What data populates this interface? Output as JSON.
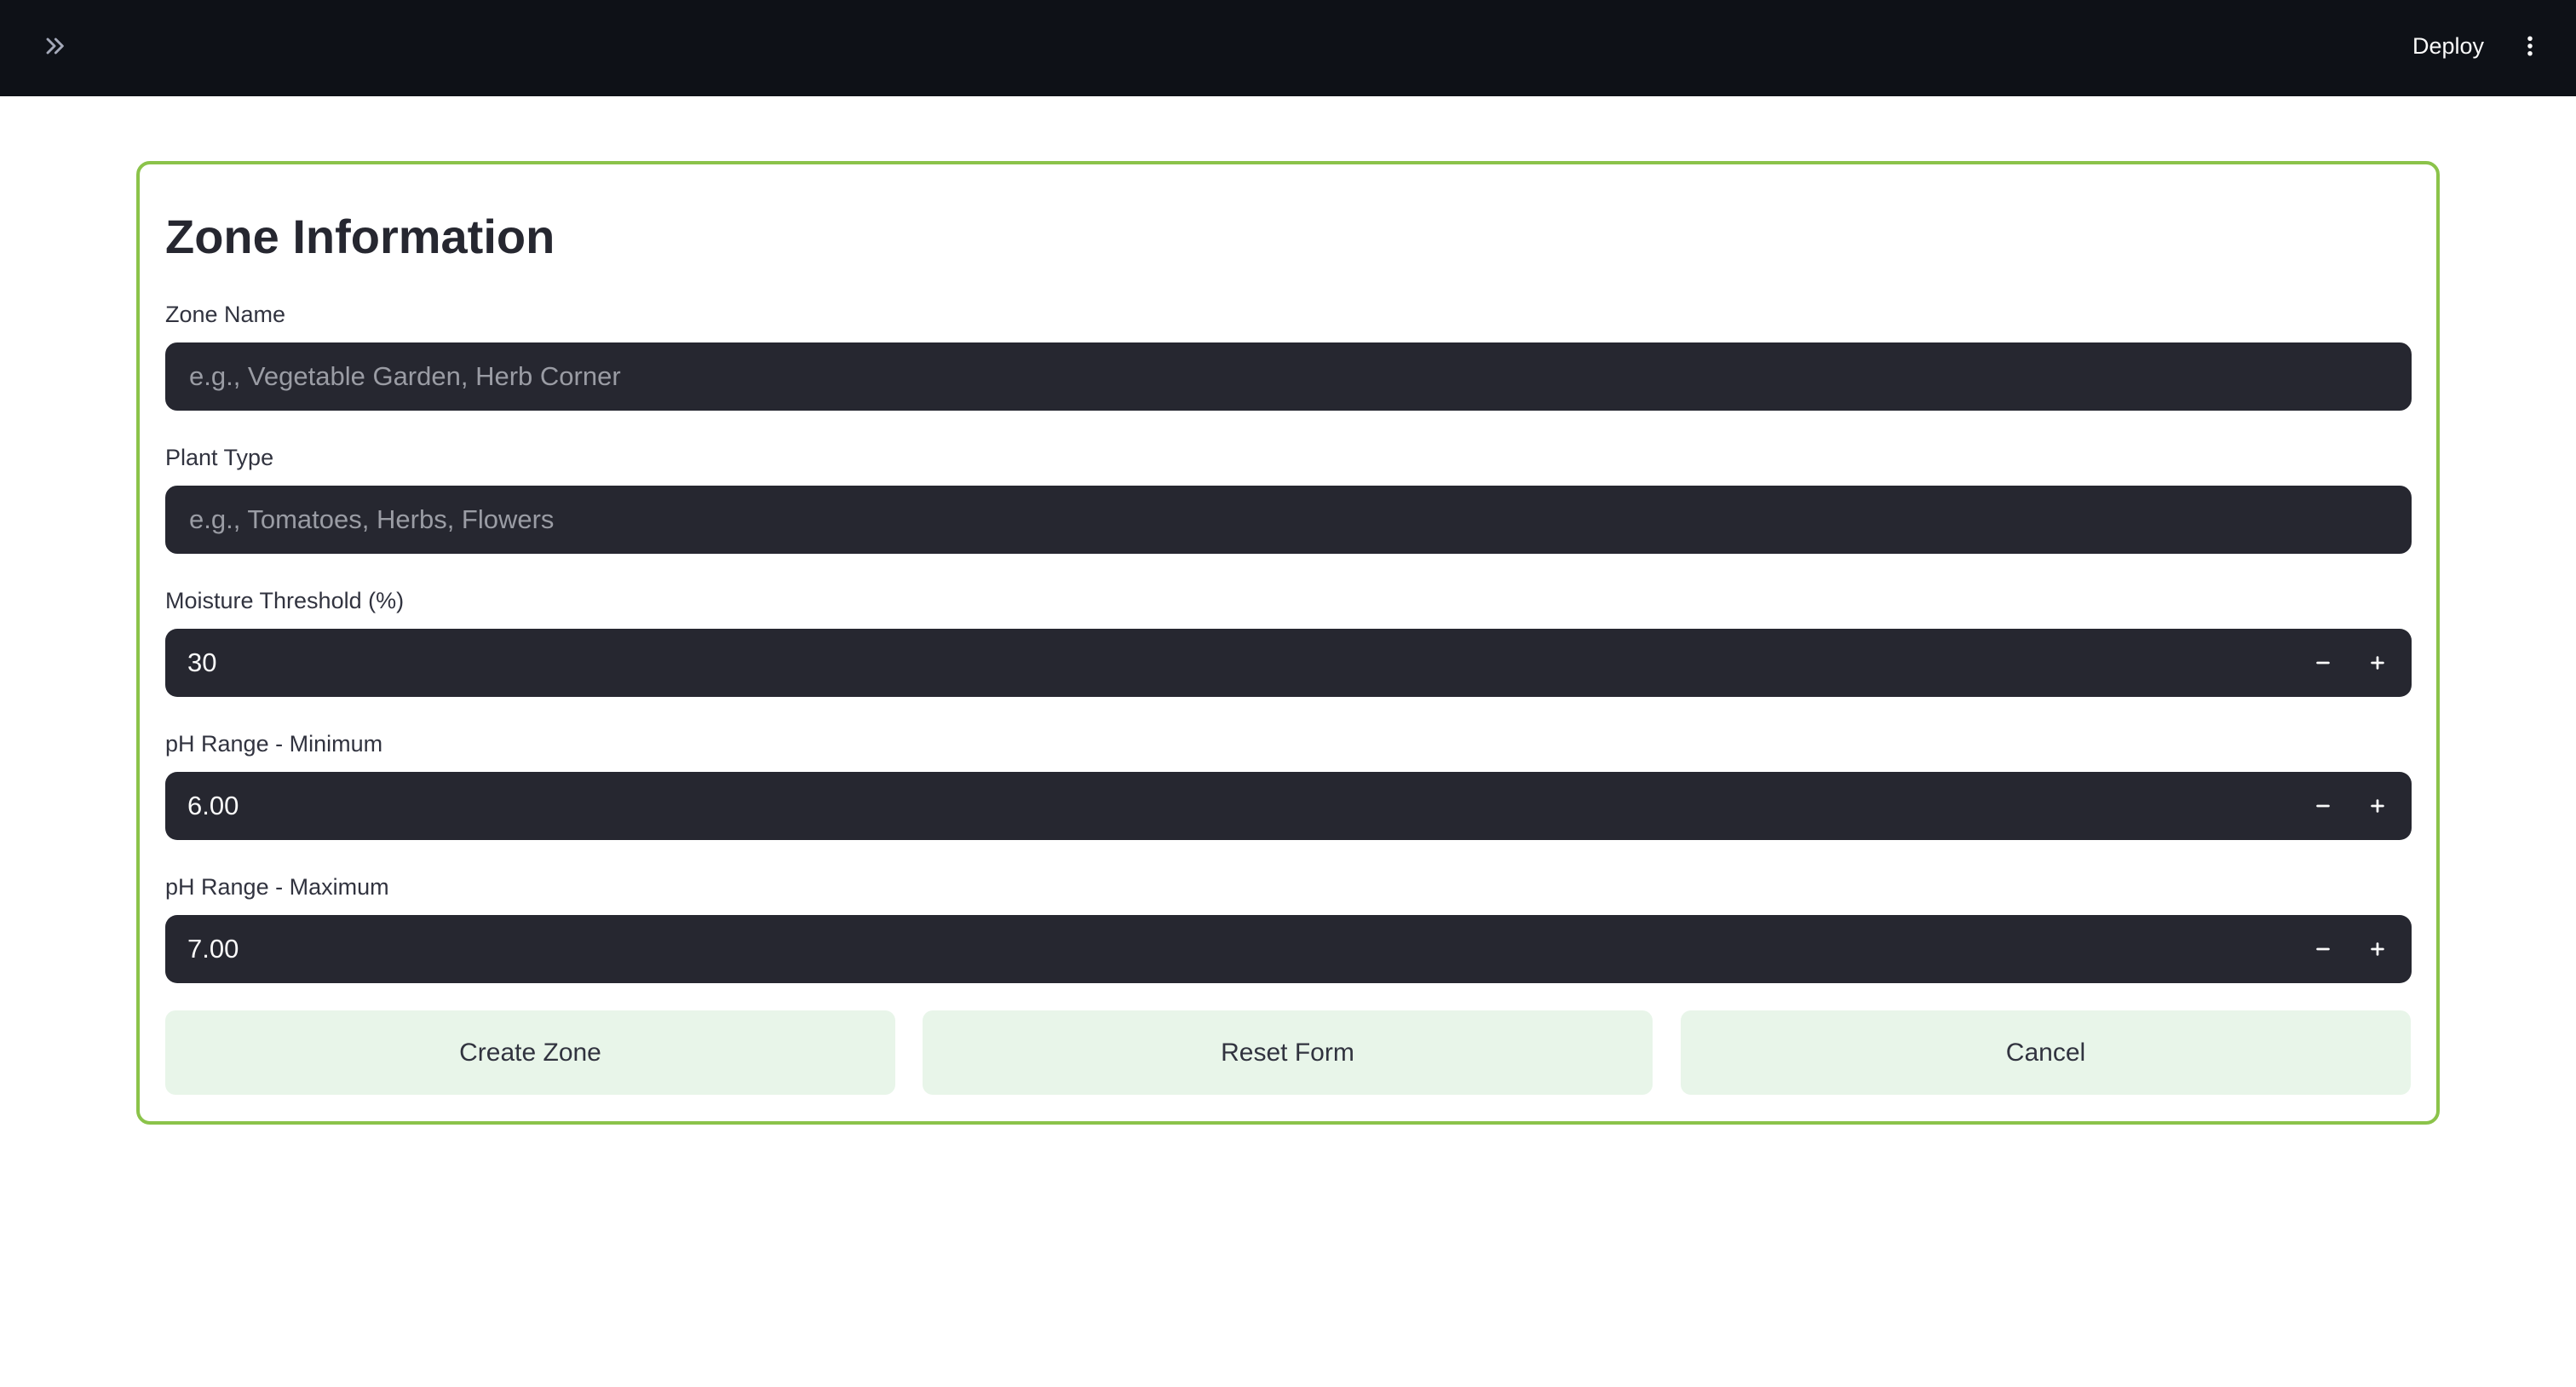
{
  "header": {
    "sidebar_toggle_icon": "chevrons-right-icon",
    "deploy_label": "Deploy",
    "menu_icon": "more-vertical-icon"
  },
  "form": {
    "title": "Zone Information",
    "zone_name": {
      "label": "Zone Name",
      "value": "",
      "placeholder": "e.g., Vegetable Garden, Herb Corner"
    },
    "plant_type": {
      "label": "Plant Type",
      "value": "",
      "placeholder": "e.g., Tomatoes, Herbs, Flowers"
    },
    "moisture_threshold": {
      "label": "Moisture Threshold (%)",
      "value": "30"
    },
    "ph_min": {
      "label": "pH Range - Minimum",
      "value": "6.00"
    },
    "ph_max": {
      "label": "pH Range - Maximum",
      "value": "7.00"
    },
    "buttons": {
      "create": "Create Zone",
      "reset": "Reset Form",
      "cancel": "Cancel"
    }
  },
  "colors": {
    "header_bg": "#0e1117",
    "card_border": "#8bc34a",
    "input_bg": "#262730",
    "button_bg": "#e8f5e9"
  }
}
